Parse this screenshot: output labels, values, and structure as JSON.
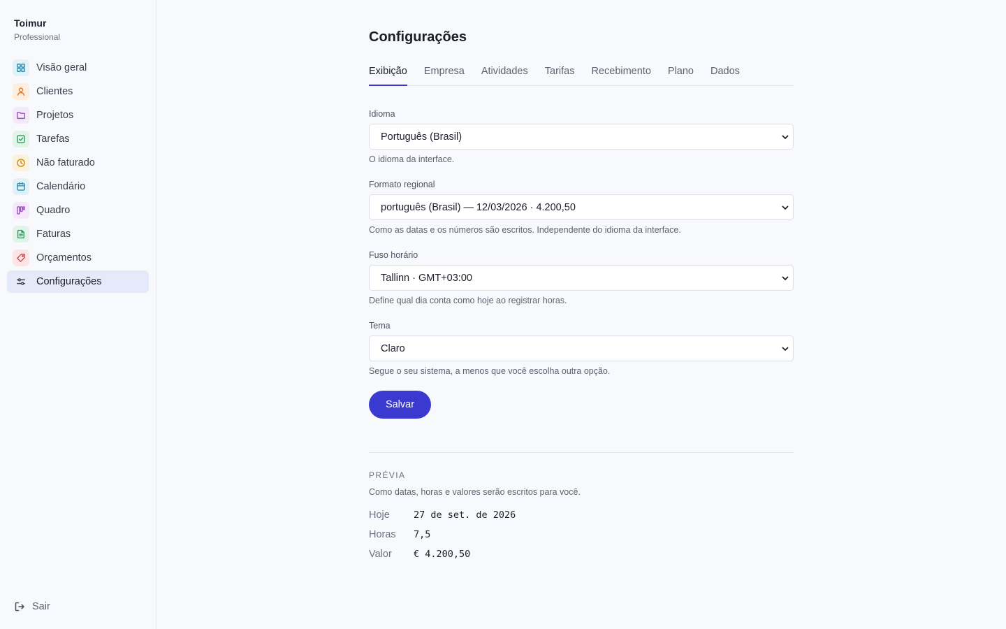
{
  "brand": {
    "name": "Toimur",
    "plan": "Professional"
  },
  "sidebar": {
    "items": [
      {
        "label": "Visão geral",
        "icon": "grid-icon",
        "color": "#2f8fb0",
        "bg": "#e2f3f8",
        "active": false
      },
      {
        "label": "Clientes",
        "icon": "user-icon",
        "color": "#d97a2b",
        "bg": "#fdeede",
        "active": false
      },
      {
        "label": "Projetos",
        "icon": "folder-icon",
        "color": "#9a4fc0",
        "bg": "#f4e9f9",
        "active": false
      },
      {
        "label": "Tarefas",
        "icon": "checkbox-icon",
        "color": "#2d9b5f",
        "bg": "#e2f4ea",
        "active": false
      },
      {
        "label": "Não faturado",
        "icon": "clock-icon",
        "color": "#c98a12",
        "bg": "#fcf1da",
        "active": false
      },
      {
        "label": "Calendário",
        "icon": "calendar-icon",
        "color": "#2a8fb0",
        "bg": "#e0f2f8",
        "active": false
      },
      {
        "label": "Quadro",
        "icon": "kanban-icon",
        "color": "#a14fc9",
        "bg": "#f4e8fa",
        "active": false
      },
      {
        "label": "Faturas",
        "icon": "document-icon",
        "color": "#2c9a5d",
        "bg": "#e2f4ea",
        "active": false
      },
      {
        "label": "Orçamentos",
        "icon": "tag-icon",
        "color": "#d24d55",
        "bg": "#fde5e6",
        "active": false
      },
      {
        "label": "Configurações",
        "icon": "sliders-icon",
        "color": "#3b3f4a",
        "bg": "transparent",
        "active": true
      }
    ],
    "logout_label": "Sair"
  },
  "page": {
    "title": "Configurações"
  },
  "tabs": [
    {
      "label": "Exibição",
      "active": true
    },
    {
      "label": "Empresa",
      "active": false
    },
    {
      "label": "Atividades",
      "active": false
    },
    {
      "label": "Tarifas",
      "active": false
    },
    {
      "label": "Recebimento",
      "active": false
    },
    {
      "label": "Plano",
      "active": false
    },
    {
      "label": "Dados",
      "active": false
    }
  ],
  "fields": {
    "language": {
      "label": "Idioma",
      "value": "Português (Brasil)",
      "hint": "O idioma da interface."
    },
    "locale": {
      "label": "Formato regional",
      "value": "português (Brasil) — 12/03/2026 · 4.200,50",
      "hint": "Como as datas e os números são escritos. Independente do idioma da interface."
    },
    "timezone": {
      "label": "Fuso horário",
      "value": "Tallinn · GMT+03:00",
      "hint": "Define qual dia conta como hoje ao registrar horas."
    },
    "theme": {
      "label": "Tema",
      "value": "Claro",
      "hint": "Segue o seu sistema, a menos que você escolha outra opção."
    }
  },
  "save_label": "Salvar",
  "preview": {
    "heading": "PRÉVIA",
    "description": "Como datas, horas e valores serão escritos para você.",
    "rows": [
      {
        "key": "Hoje",
        "value": "27 de set. de 2026"
      },
      {
        "key": "Horas",
        "value": "7,5"
      },
      {
        "key": "Valor",
        "value": "€ 4.200,50"
      }
    ]
  },
  "colors": {
    "accent": "#3a3ad0",
    "active_nav_bg": "#e6e9fa",
    "background": "#f8f9fc"
  }
}
